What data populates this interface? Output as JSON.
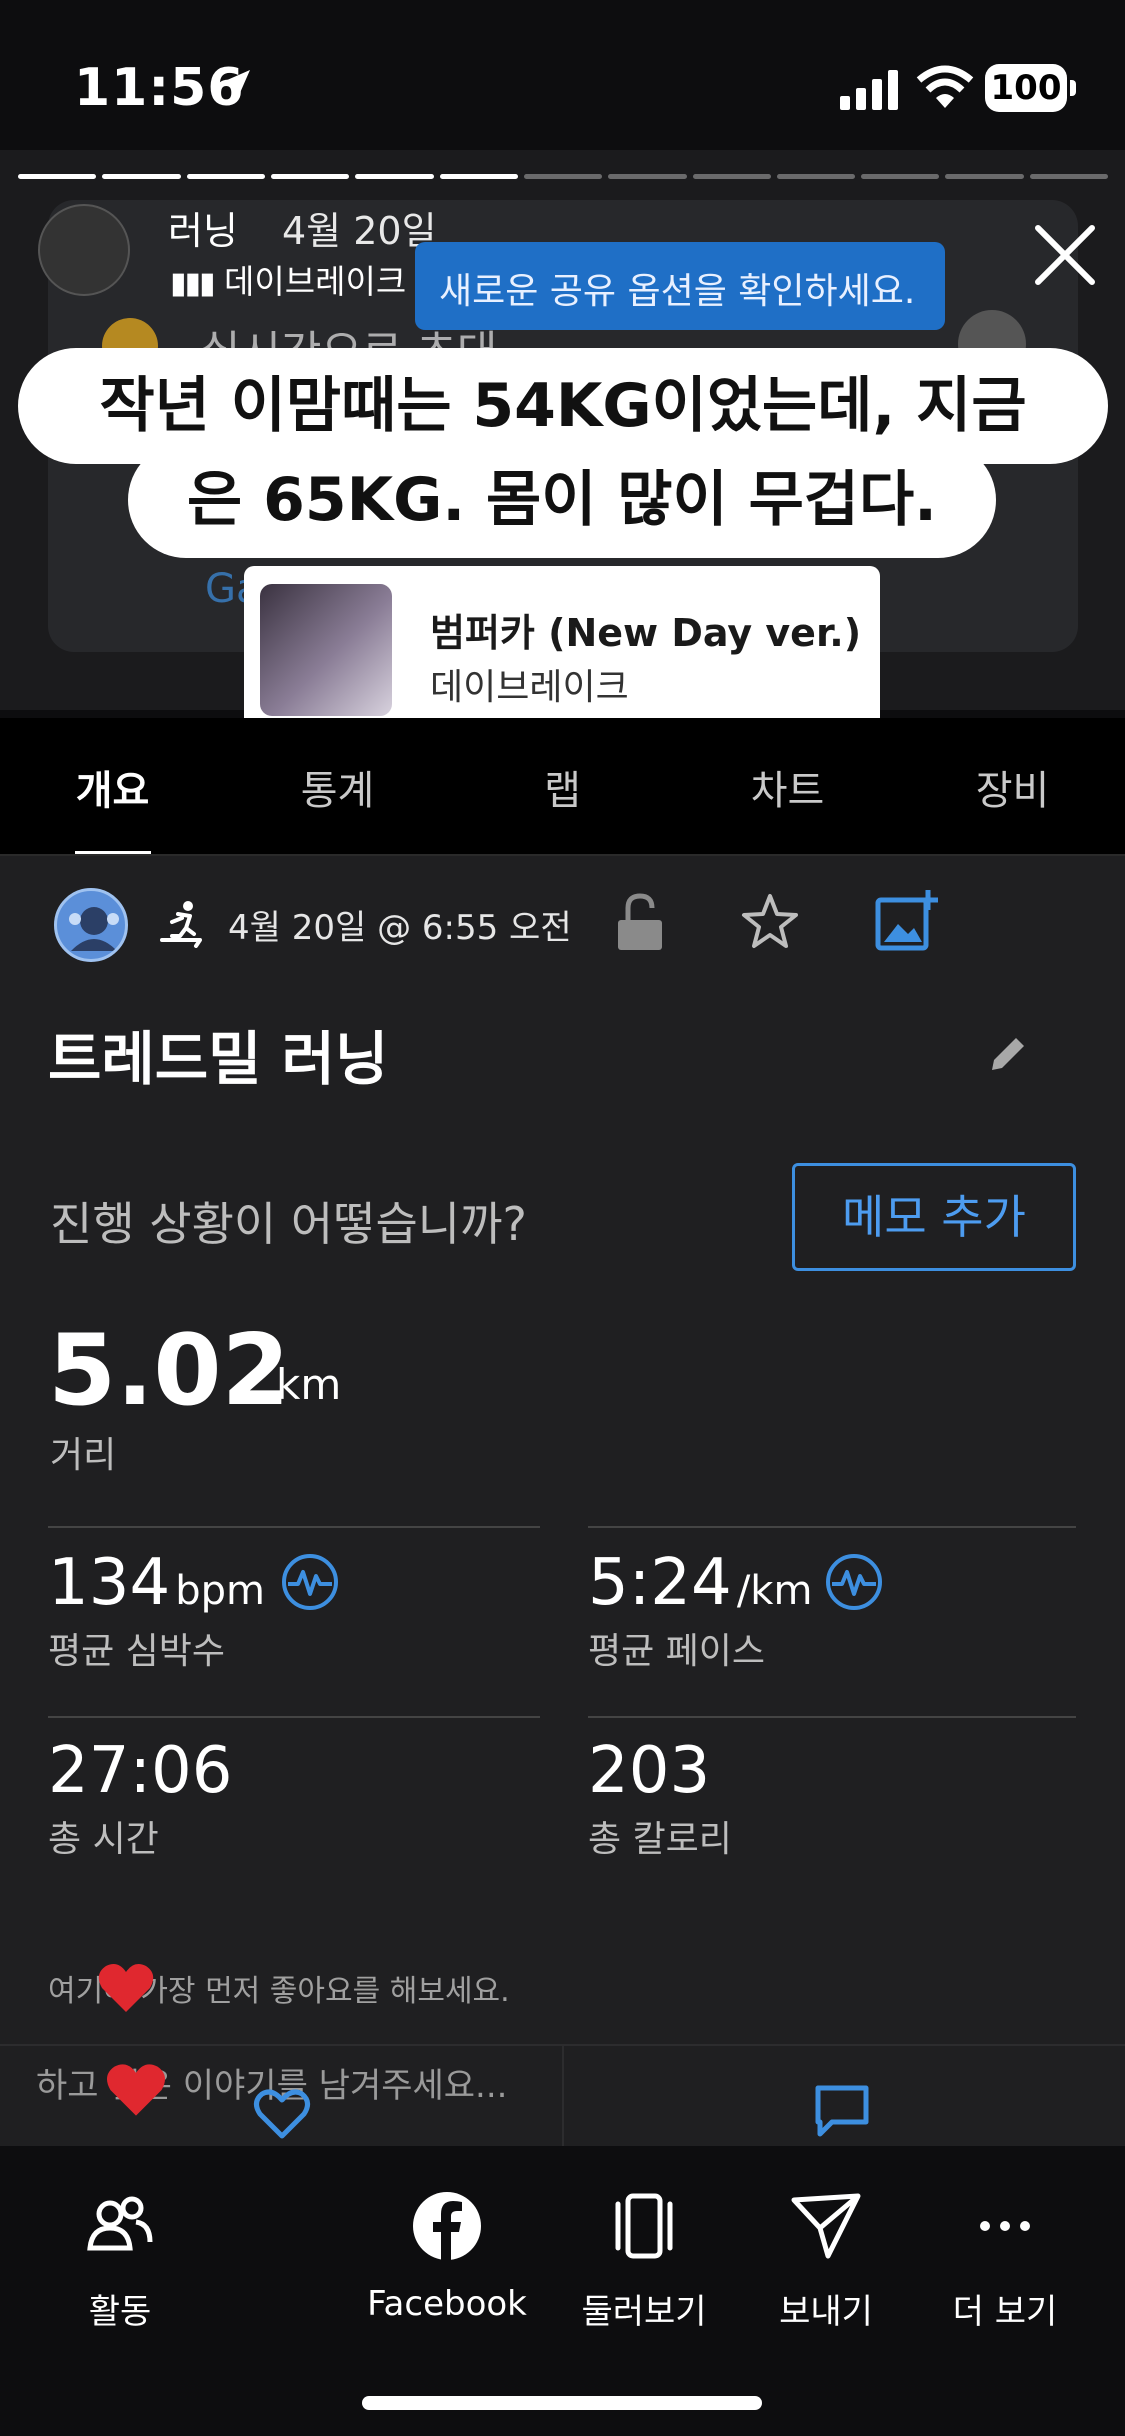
{
  "status_bar": {
    "time": "11:56",
    "battery": "100"
  },
  "story": {
    "title": "러닝",
    "date": "4월 20일",
    "music_line": "데이브레이크 · 범퍼카 (New Day ver.)",
    "tooltip": "새로운 공유 옵션을 확인하세요.",
    "bg_heading": "실시간으로 초대",
    "bg_link": "Garmin Connect 계정",
    "caption_line1": "작년 이맘때는 54KG이었는데, 지금",
    "caption_line2": "은 65KG. 몸이 많이 무겁다.",
    "music_card": {
      "title": "범퍼카 (New Day ver.)",
      "artist": "데이브레이크"
    }
  },
  "tabs": [
    {
      "label": "개요",
      "active": true
    },
    {
      "label": "통계",
      "active": false
    },
    {
      "label": "랩",
      "active": false
    },
    {
      "label": "차트",
      "active": false
    },
    {
      "label": "장비",
      "active": false
    }
  ],
  "activity": {
    "date": "4월 20일 @ 6:55 오전",
    "title": "트레드밀 러닝",
    "question": "진행 상황이 어떻습니까?",
    "memo_button": "메모 추가",
    "distance": {
      "value": "5.02",
      "unit": "km",
      "label": "거리"
    },
    "stats": [
      {
        "value": "134",
        "unit": "bpm",
        "label": "평균 심박수",
        "icon": "pulse-icon"
      },
      {
        "value": "5:24",
        "unit": "/km",
        "label": "평균 페이스",
        "icon": "pulse-icon"
      },
      {
        "value": "27:06",
        "unit": "",
        "label": "총 시간"
      },
      {
        "value": "203",
        "unit": "",
        "label": "총 칼로리"
      }
    ],
    "like_prompt": "여기에 가장 먼저 좋아요를 해보세요.",
    "comment_placeholder": "하고 싶은 이야기를 남겨주세요..."
  },
  "bottom_bar": [
    {
      "label": "활동",
      "icon": "people-icon"
    },
    {
      "label": "Facebook",
      "icon": "facebook-icon"
    },
    {
      "label": "둘러보기",
      "icon": "browse-icon"
    },
    {
      "label": "보내기",
      "icon": "send-icon"
    },
    {
      "label": "더 보기",
      "icon": "more-icon"
    }
  ],
  "colors": {
    "accent": "#3d8fe0",
    "background": "#1f1f21",
    "heart": "#e0282f"
  }
}
